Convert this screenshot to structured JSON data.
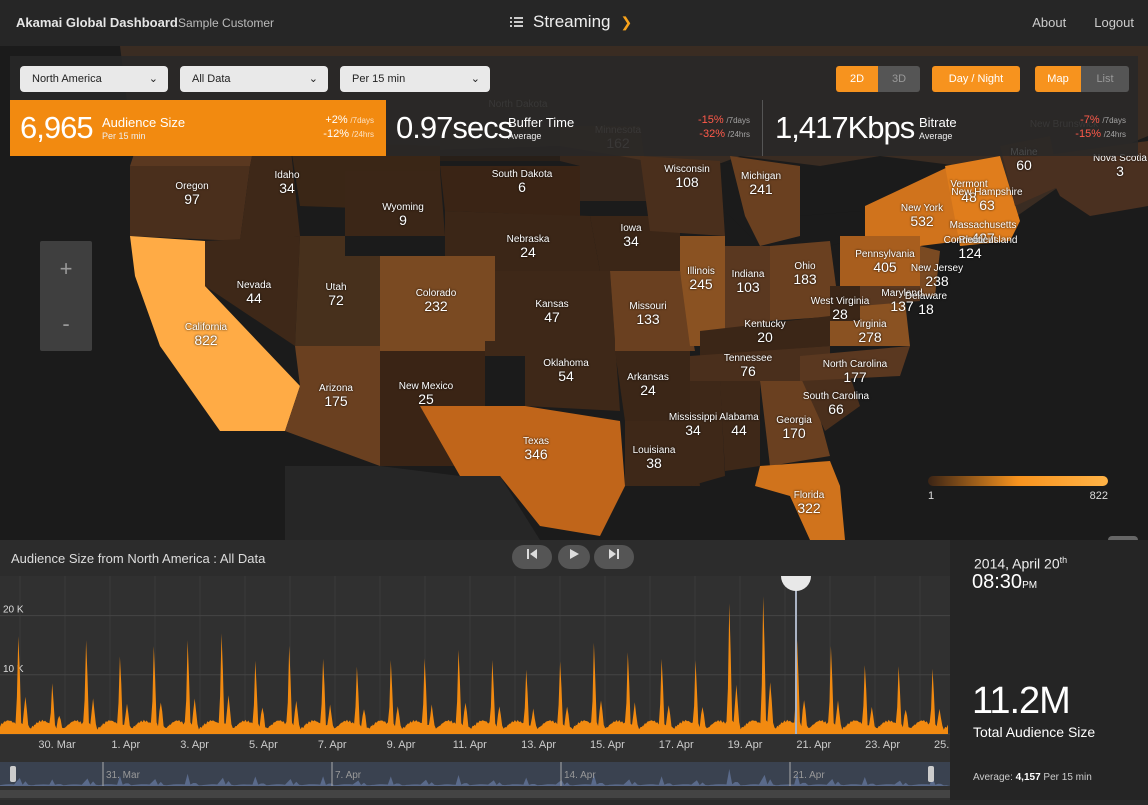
{
  "app": {
    "brand": "Akamai Global Dashboard",
    "customer": "Sample Customer",
    "section": "Streaming",
    "links": [
      "About",
      "Logout"
    ]
  },
  "filters": {
    "region": "North America",
    "data": "All Data",
    "interval": "Per 15 min"
  },
  "view_toggles": {
    "dim_2d": "2D",
    "dim_3d": "3D",
    "day_night": "Day / Night",
    "map": "Map",
    "list": "List"
  },
  "stats": [
    {
      "value": "6,965",
      "title": "Audience Size",
      "sub": "Per 15 min",
      "chg7": "+2%",
      "chg24": "-12%",
      "lbl7": "/7days",
      "lbl24": "/24hrs"
    },
    {
      "value": "0.97secs",
      "title": "Buffer Time",
      "sub": "Average",
      "chg7": "-15%",
      "chg24": "-32%",
      "lbl7": "/7days",
      "lbl24": "/24hrs"
    },
    {
      "value": "1,417Kbps",
      "title": "Bitrate",
      "sub": "Average",
      "chg7": "-7%",
      "chg24": "-15%",
      "lbl7": "/7days",
      "lbl24": "/24hrs"
    }
  ],
  "map": {
    "zoom_in": "+",
    "zoom_out": "-",
    "legend": {
      "min": "1",
      "max": "822"
    },
    "states": [
      {
        "name": "Oregon",
        "value": "97"
      },
      {
        "name": "Idaho",
        "value": "34"
      },
      {
        "name": "South Dakota",
        "value": "6"
      },
      {
        "name": "Wyoming",
        "value": "9"
      },
      {
        "name": "Nebraska",
        "value": "24"
      },
      {
        "name": "Iowa",
        "value": "34"
      },
      {
        "name": "Wisconsin",
        "value": "108"
      },
      {
        "name": "Michigan",
        "value": "241"
      },
      {
        "name": "Minnesota",
        "value": "162"
      },
      {
        "name": "North Dakota",
        "value": ""
      },
      {
        "name": "Nevada",
        "value": "44"
      },
      {
        "name": "Utah",
        "value": "72"
      },
      {
        "name": "Colorado",
        "value": "232"
      },
      {
        "name": "Kansas",
        "value": "47"
      },
      {
        "name": "Missouri",
        "value": "133"
      },
      {
        "name": "Illinois",
        "value": "245"
      },
      {
        "name": "Indiana",
        "value": "103"
      },
      {
        "name": "Ohio",
        "value": "183"
      },
      {
        "name": "Pennsylvania",
        "value": "405"
      },
      {
        "name": "New York",
        "value": "532"
      },
      {
        "name": "California",
        "value": "822"
      },
      {
        "name": "Arizona",
        "value": "175"
      },
      {
        "name": "New Mexico",
        "value": "25"
      },
      {
        "name": "Oklahoma",
        "value": "54"
      },
      {
        "name": "Arkansas",
        "value": "24"
      },
      {
        "name": "Texas",
        "value": "346"
      },
      {
        "name": "Louisiana",
        "value": "38"
      },
      {
        "name": "Mississippi",
        "value": "34"
      },
      {
        "name": "Alabama",
        "value": "44"
      },
      {
        "name": "Georgia",
        "value": "170"
      },
      {
        "name": "Florida",
        "value": "322"
      },
      {
        "name": "Tennessee",
        "value": "76"
      },
      {
        "name": "Kentucky",
        "value": "20"
      },
      {
        "name": "West Virginia",
        "value": "28"
      },
      {
        "name": "Virginia",
        "value": "278"
      },
      {
        "name": "North Carolina",
        "value": "177"
      },
      {
        "name": "South Carolina",
        "value": "66"
      },
      {
        "name": "Maryland",
        "value": "137"
      },
      {
        "name": "Delaware",
        "value": "18"
      },
      {
        "name": "New Jersey",
        "value": "238"
      },
      {
        "name": "Vermont",
        "value": "48"
      },
      {
        "name": "New Hampshire",
        "value": "63"
      },
      {
        "name": "Massachusetts",
        "value": "427"
      },
      {
        "name": "Rhode Island",
        "value": ""
      },
      {
        "name": "Connecticut",
        "value": "124"
      },
      {
        "name": "Maine",
        "value": "60"
      },
      {
        "name": "Nova Scotia",
        "value": "3"
      },
      {
        "name": "New Brunswick",
        "value": ""
      }
    ]
  },
  "chart": {
    "title": "Audience Size from North America : All Data",
    "date": "2014, April 20",
    "date_sup": "th",
    "time": "08:30",
    "ampm": "PM",
    "total": "11.2M",
    "total_label": "Total Audience Size",
    "avg_label": "Average: ",
    "avg_value": "4,157",
    "avg_unit": " Per 15 min"
  },
  "chart_data": {
    "type": "area",
    "title": "Audience Size from North America : All Data",
    "y_ticks": [
      "0 K",
      "10 K",
      "20 K"
    ],
    "ylim": [
      0,
      25000
    ],
    "x_ticks": [
      "30. Mar",
      "1. Apr",
      "3. Apr",
      "5. Apr",
      "7. Apr",
      "9. Apr",
      "11. Apr",
      "13. Apr",
      "15. Apr",
      "17. Apr",
      "19. Apr",
      "21. Apr",
      "23. Apr",
      "25. Apr"
    ],
    "nav_ticks": [
      "31. Mar",
      "7. Apr",
      "14. Apr",
      "21. Apr"
    ],
    "daily_peaks": [
      16000,
      7500,
      15000,
      12500,
      14000,
      15000,
      16500,
      11500,
      14000,
      12000,
      10500,
      11500,
      12000,
      13500,
      11500,
      10000,
      11500,
      14500,
      13000,
      12000,
      11500,
      21500,
      23000,
      15000,
      14000,
      11000,
      10500,
      10000
    ],
    "series_color": "#f28a10"
  }
}
